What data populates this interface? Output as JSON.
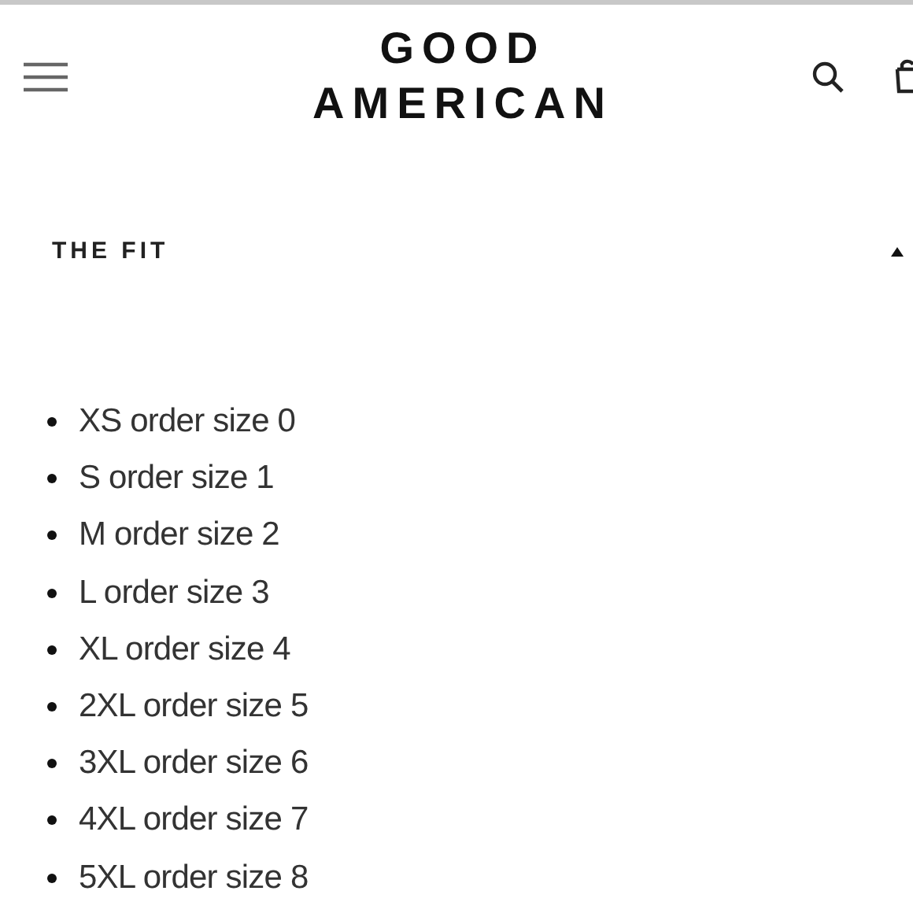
{
  "header": {
    "logo_lines": [
      "GOOD",
      "AMERICAN"
    ]
  },
  "section": {
    "title": "THE FIT",
    "expanded": true,
    "items": [
      "XS order size 0",
      "S order size 1",
      "M order size 2",
      "L order size 3",
      "XL order size 4",
      "2XL order size 5",
      "3XL order size 6",
      "4XL order size 7",
      "5XL order size 8"
    ]
  }
}
